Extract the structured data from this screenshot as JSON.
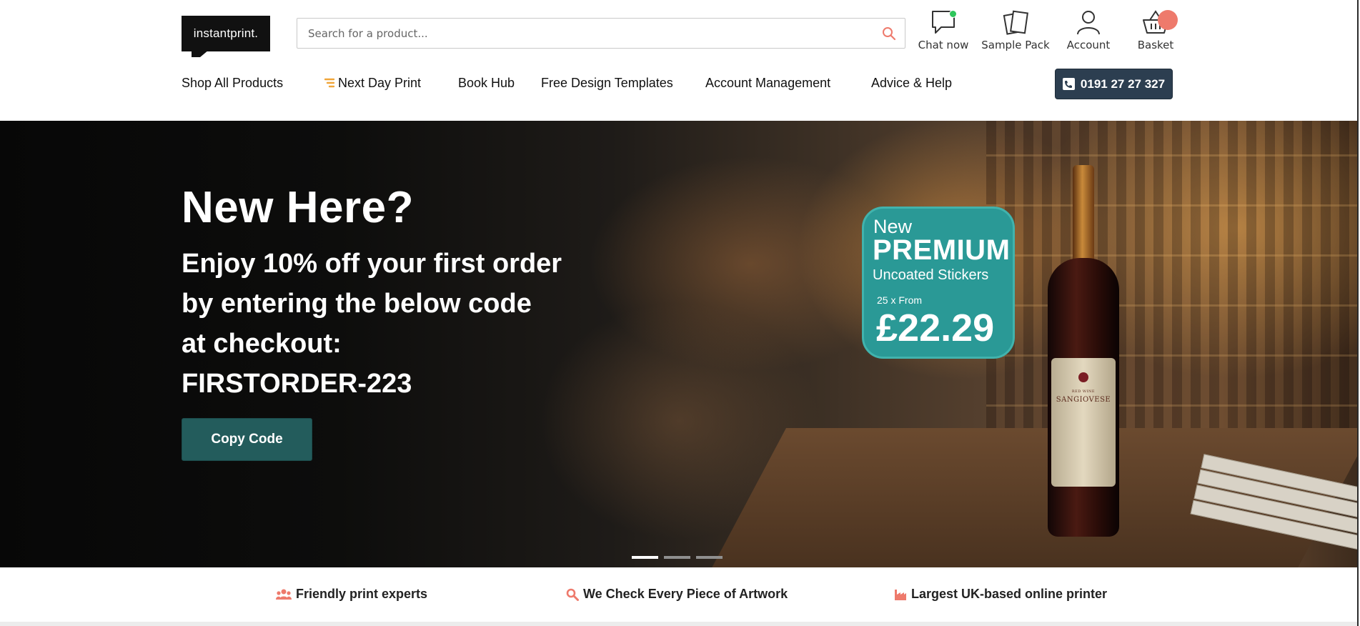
{
  "brand": {
    "logo_text": "instantprint.",
    "accent": "#ee7a6c",
    "teal": "#235c5c",
    "navy": "#2c3e50"
  },
  "search": {
    "placeholder": "Search for a product..."
  },
  "header_icons": {
    "chat": "Chat now",
    "sample": "Sample Pack",
    "account": "Account",
    "basket": "Basket"
  },
  "nav": {
    "items": [
      {
        "label": "Shop All Products"
      },
      {
        "label": "Next Day Print"
      },
      {
        "label": "Book Hub"
      },
      {
        "label": "Free Design Templates"
      },
      {
        "label": "Account Management"
      },
      {
        "label": "Advice & Help"
      }
    ],
    "phone": "0191 27 27 327"
  },
  "hero": {
    "title": "New Here?",
    "lines": [
      "Enjoy 10% off your first order",
      "by entering the below code",
      "at checkout:",
      "FIRSTORDER-223"
    ],
    "button": "Copy Code",
    "slides": 3,
    "active_slide": 1
  },
  "promo_badge": {
    "new": "New",
    "premium": "PREMIUM",
    "product": "Uncoated Stickers",
    "qty": "25 x From",
    "price": "£22.29"
  },
  "bottle_label": {
    "line1": "RED WINE",
    "line2": "SANGIOVESE"
  },
  "usp": [
    {
      "icon": "users-icon",
      "label": "Friendly print experts"
    },
    {
      "icon": "magnifier-icon",
      "label": "We Check Every Piece of Artwork"
    },
    {
      "icon": "factory-icon",
      "label": "Largest UK-based online printer"
    }
  ]
}
